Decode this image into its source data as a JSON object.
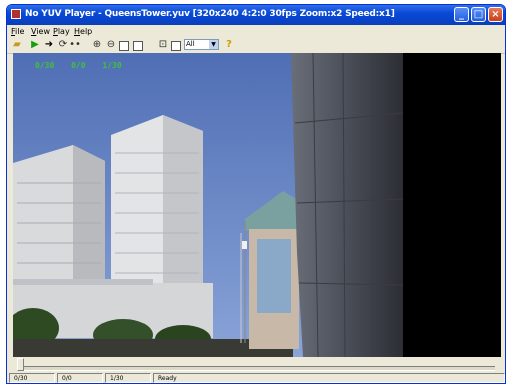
{
  "window": {
    "title": "No YUV Player - QueensTower.yuv [320x240 4:2:0 30fps Zoom:x2 Speed:x1]",
    "min_glyph": "_",
    "max_glyph": "□",
    "close_glyph": "×"
  },
  "menu": {
    "items": [
      "File",
      "View",
      "Play",
      "Help"
    ]
  },
  "toolbar": {
    "icons": [
      "open-folder-icon",
      "play-icon",
      "step-forward-icon",
      "loop-icon",
      "step-icon",
      "zoom-in-icon",
      "zoom-out-icon",
      "fit-icon",
      "frame-icon",
      "fullscreen-icon",
      "blank-icon",
      "help-icon"
    ],
    "component_select": "All",
    "select_arrow": "▼"
  },
  "overlay": {
    "frame": "0/30",
    "zero": "0/0",
    "total": "1/30"
  },
  "seek": {
    "position": 0
  },
  "status": {
    "frame": "0/30",
    "zero": "0/0",
    "total": "1/30",
    "state": "Ready"
  },
  "colors": {
    "titlebar": "#0a4ad6",
    "overlay_text": "#40c040",
    "sky": "#5a78b8"
  }
}
